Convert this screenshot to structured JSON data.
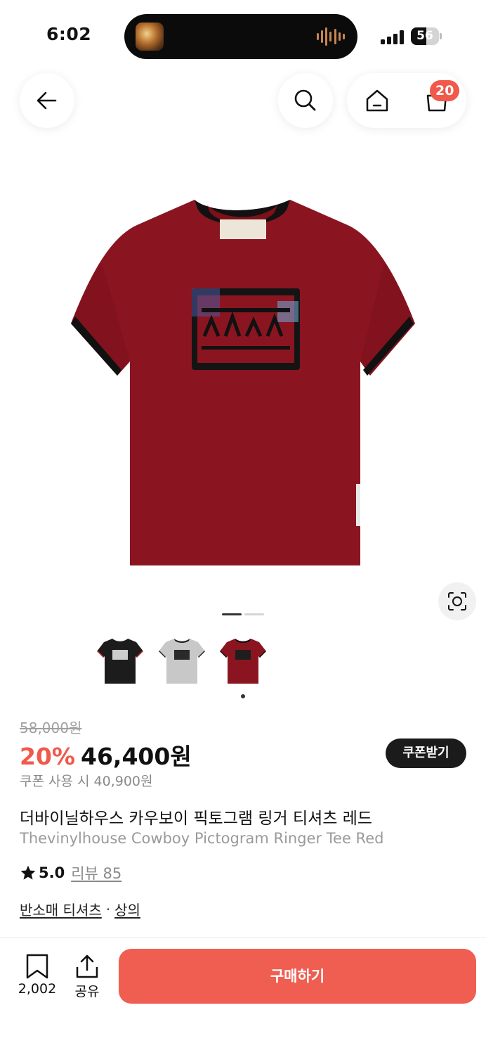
{
  "status_bar": {
    "time": "6:02",
    "battery": "56",
    "battery_level": 0.56
  },
  "nav": {
    "cart_count": "20"
  },
  "gallery": {
    "current_index": 1,
    "total": 2,
    "colors": [
      "#1c1c1c",
      "#c8c8c8",
      "#8a1520"
    ],
    "selected_color_index": 2
  },
  "product": {
    "original_price": "58,000원",
    "discount": "20%",
    "final_price": "46,400원",
    "coupon_button": "쿠폰받기",
    "coupon_price": "쿠폰 사용 시 40,900원",
    "title_kr": "더바이닐하우스 카우보이 픽토그램 링거 티셔츠 레드",
    "title_en": "Thevinylhouse Cowboy Pictogram Ringer Tee Red",
    "rating": "5.0",
    "review_label": "리뷰 85",
    "categories": [
      "반소매 티셔츠",
      "상의"
    ],
    "category_separator": "·"
  },
  "bottom_bar": {
    "like_count": "2,002",
    "share_label": "공유",
    "buy_label": "구매하기"
  },
  "colors": {
    "accent": "#ef5e50",
    "shirt": "#8a1520",
    "dark": "#1b1b1b"
  }
}
